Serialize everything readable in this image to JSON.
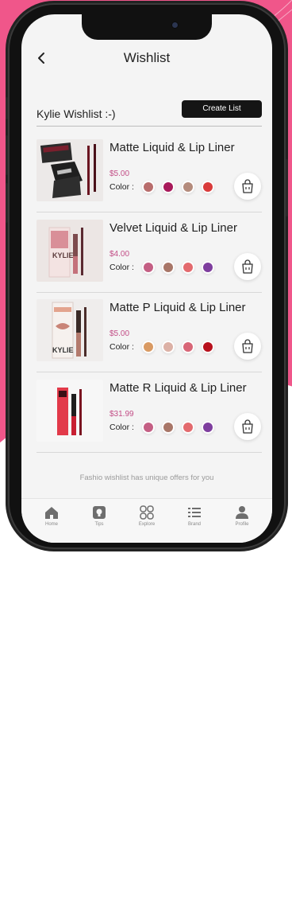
{
  "header": {
    "title": "Wishlist"
  },
  "wishlist": {
    "name": "Kylie Wishlist :-)",
    "create_label": "Create List"
  },
  "color_label": "Color :",
  "items": [
    {
      "name": "Matte Liquid & Lip Liner",
      "price": "$5.00",
      "colors": [
        "#b86d6c",
        "#a8195a",
        "#b48b7c",
        "#d93b3b"
      ]
    },
    {
      "name": "Velvet Liquid & Lip Liner",
      "price": "$4.00",
      "colors": [
        "#c45f84",
        "#a87668",
        "#e36a6e",
        "#7e3e9e"
      ]
    },
    {
      "name": "Matte P Liquid & Lip Liner",
      "price": "$5.00",
      "colors": [
        "#d99a63",
        "#dcb1a6",
        "#d86677",
        "#b8111d"
      ]
    },
    {
      "name": "Matte R Liquid & Lip Liner",
      "price": "$31.99",
      "colors": [
        "#c45f84",
        "#a87668",
        "#e36a6e",
        "#7e3e9e"
      ]
    }
  ],
  "footer_note": "Fashio wishlist has unique offers for you",
  "tabs": [
    {
      "label": "Home",
      "icon": "home-icon"
    },
    {
      "label": "Tips",
      "icon": "tips-icon"
    },
    {
      "label": "Explore",
      "icon": "explore-icon"
    },
    {
      "label": "Brand",
      "icon": "brand-icon"
    },
    {
      "label": "Profile",
      "icon": "profile-icon"
    }
  ],
  "thumb_texts": {
    "kylie": "KYLIE"
  },
  "colors": {
    "accent_pink": "#f0568a",
    "price_pink": "#c24d86",
    "button_dark": "#151515"
  }
}
